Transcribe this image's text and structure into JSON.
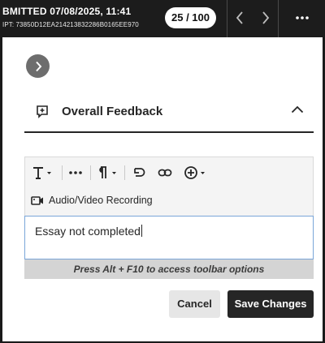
{
  "header": {
    "submission_status": "BMITTED 07/08/2025, 11:41",
    "receipt": "IPT: 73850D12EA214213832286B0165EE970",
    "counter": "25 / 100"
  },
  "feedback": {
    "title": "Overall Feedback"
  },
  "editor": {
    "av_label": "Audio/Video Recording",
    "text_value": "Essay not completed",
    "hint": "Press Alt + F10 to access toolbar options"
  },
  "actions": {
    "cancel_label": "Cancel",
    "save_label": "Save Changes"
  },
  "icons": {
    "prev": "chevron-left-icon",
    "next": "chevron-right-icon",
    "more": "more-horizontal-icon",
    "expand": "chevron-right-circle-icon",
    "feedback": "feedback-icon",
    "collapse": "chevron-up-icon",
    "text_format": "text-format-icon",
    "more_options": "ellipsis-icon",
    "paragraph": "paragraph-icon",
    "undo": "undo-icon",
    "link": "link-icon",
    "insert": "add-circle-icon",
    "video": "video-camera-icon"
  },
  "colors": {
    "header_bg": "#1c1c1c",
    "primary_button": "#262626",
    "secondary_button": "#e6e6e6",
    "focus_border": "#7aa6d8"
  }
}
